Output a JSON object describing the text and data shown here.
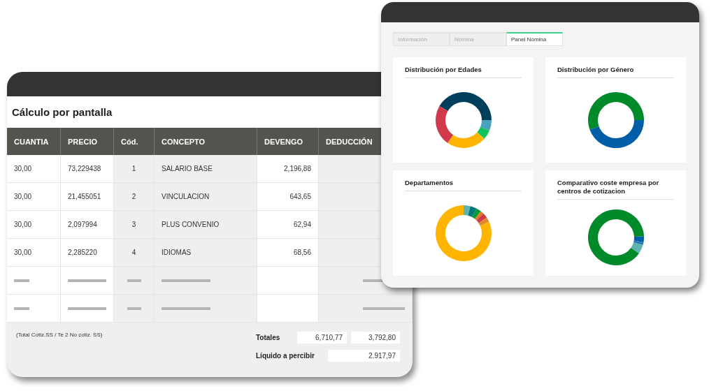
{
  "calc_window": {
    "title": "Cálculo por pantalla",
    "columns": [
      "CUANTIA",
      "PRECIO",
      "Cód.",
      "CONCEPTO",
      "DEVENGO",
      "DEDUCCIÓN"
    ],
    "rows": [
      {
        "kind": "data",
        "cells": [
          "30,00",
          "73,229438",
          "1",
          "SALARIO BASE",
          "2,196,88"
        ]
      },
      {
        "kind": "data",
        "cells": [
          "30,00",
          "21,455051",
          "2",
          "VINCULACION",
          "643,65"
        ]
      },
      {
        "kind": "data",
        "cells": [
          "30,00",
          "2,097994",
          "3",
          "PLUS CONVENIO",
          "62,94"
        ]
      },
      {
        "kind": "data",
        "cells": [
          "30,00",
          "2,285220",
          "4",
          "IDIOMAS",
          "68,56"
        ]
      },
      {
        "kind": "placeholder"
      },
      {
        "kind": "placeholder"
      }
    ],
    "note": "(Total Cotiz.SS / Te 2 No cotiz. SS)",
    "totals": {
      "label": "Totales",
      "devengo": "6,710,77",
      "deduccion": "3,792,80"
    },
    "net": {
      "label": "Líquido a percibir",
      "value": "2.917,97"
    }
  },
  "panel_window": {
    "tabs": [
      {
        "label": "Información",
        "selected": false
      },
      {
        "label": "Nómina",
        "selected": false
      },
      {
        "label": "Panel Nómina",
        "selected": true
      }
    ],
    "cards": [
      {
        "title": "Distribución por Edades"
      },
      {
        "title": "Distribución por Género"
      },
      {
        "title": "Departamentos"
      },
      {
        "title": "Comparativo coste empresa por centros de cotizacion"
      }
    ]
  }
}
